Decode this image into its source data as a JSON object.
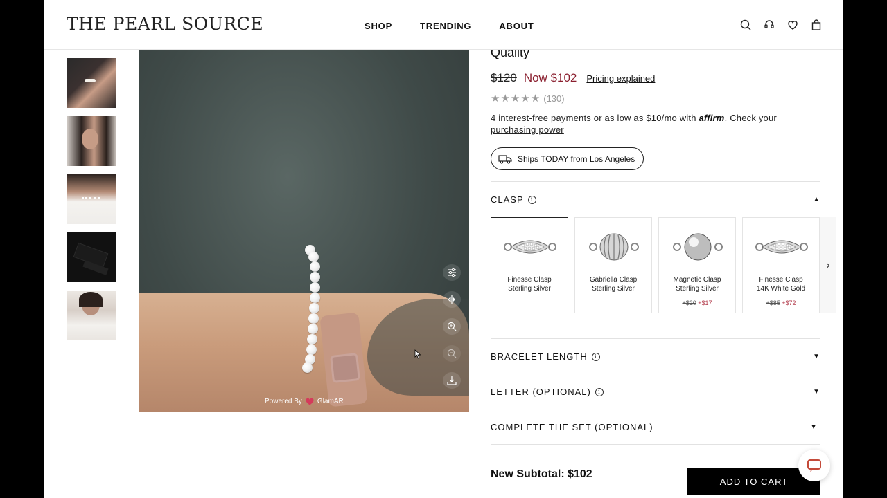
{
  "brand": "The Pearl Source",
  "nav": [
    "SHOP",
    "TRENDING",
    "ABOUT"
  ],
  "header_icons": [
    "search-icon",
    "support-icon",
    "heart-icon",
    "bag-icon"
  ],
  "thumbnails": [
    "thumb-hand-bracelet",
    "thumb-model-face",
    "thumb-model-white-shirt",
    "thumb-gift-box",
    "thumb-model-portrait"
  ],
  "viewer": {
    "powered_by": "Powered By",
    "powered_brand": "GlamAR",
    "tools": [
      "adjust-icon",
      "compare-icon",
      "zoom-in-icon",
      "zoom-out-icon",
      "download-icon"
    ]
  },
  "product": {
    "title_tail": "Quality",
    "old_price": "$120",
    "now_price": "Now $102",
    "pricing_link": "Pricing explained",
    "stars": "★★★★★",
    "review_count": "(130)",
    "affirm_text": "4 interest-free payments or as low as $10/mo with",
    "affirm_brand": "affirm",
    "affirm_link": "Check your purchasing power",
    "ships": "Ships TODAY from Los Angeles"
  },
  "sections": {
    "clasp": "CLASP",
    "bracelet_length": "BRACELET LENGTH",
    "letter": "LETTER (OPTIONAL)",
    "complete_set": "COMPLETE THE SET (OPTIONAL)"
  },
  "clasps": [
    {
      "name1": "Finesse Clasp",
      "name2": "Sterling Silver",
      "old": "",
      "new": "",
      "selected": true
    },
    {
      "name1": "Gabriella Clasp",
      "name2": "Sterling Silver",
      "old": "",
      "new": "",
      "selected": false
    },
    {
      "name1": "Magnetic Clasp",
      "name2": "Sterling Silver",
      "old": "+$20",
      "new": "+$17",
      "selected": false
    },
    {
      "name1": "Finesse Clasp",
      "name2": "14K White Gold",
      "old": "+$85",
      "new": "+$72",
      "selected": false
    }
  ],
  "subtotal": "New Subtotal: $102",
  "add_to_cart": "ADD TO CART",
  "colors": {
    "sale": "#8a1e2e",
    "accent_black": "#000000"
  }
}
